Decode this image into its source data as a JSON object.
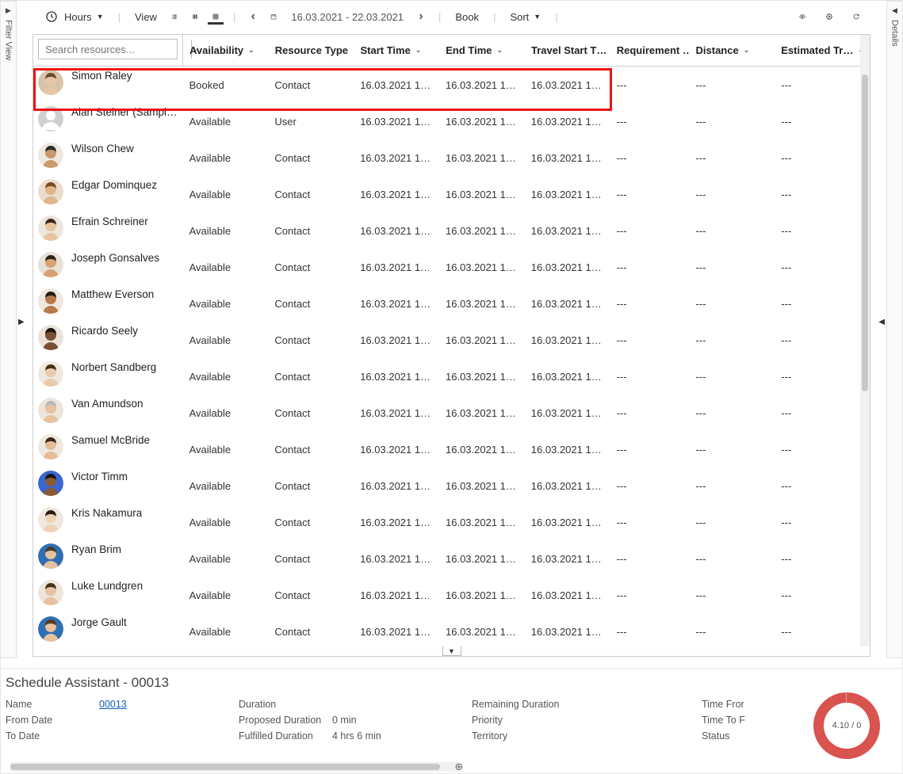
{
  "toolbar": {
    "hours_label": "Hours",
    "view_label": "View",
    "date_range": "16.03.2021 - 22.03.2021",
    "book_label": "Book",
    "sort_label": "Sort"
  },
  "side": {
    "left_label": "Filter View",
    "right_label": "Details"
  },
  "search": {
    "placeholder": "Search resources..."
  },
  "columns": {
    "availability": "Availability",
    "resource_type": "Resource Type",
    "start_time": "Start Time",
    "end_time": "End Time",
    "travel_start": "Travel Start T…",
    "requirement": "Requirement …",
    "distance": "Distance",
    "estimated": "Estimated Tr…"
  },
  "rows": [
    {
      "name": "Simon Raley",
      "availability": "Booked",
      "type": "Contact",
      "start": "16.03.2021 1…",
      "end": "16.03.2021 1…",
      "travel": "16.03.2021 1…",
      "req": "---",
      "dist": "---",
      "est": "---",
      "avatarBg": "#d8c4a8",
      "avatarSkin": "#e6c8a8",
      "avatarHair": "#6b4a2e"
    },
    {
      "name": "Alan Steiner (Sampl…",
      "availability": "Available",
      "type": "User",
      "start": "16.03.2021 1…",
      "end": "16.03.2021 1…",
      "travel": "16.03.2021 1…",
      "req": "---",
      "dist": "---",
      "est": "---",
      "placeholder": true
    },
    {
      "name": "Wilson Chew",
      "availability": "Available",
      "type": "Contact",
      "start": "16.03.2021 1…",
      "end": "16.03.2021 1…",
      "travel": "16.03.2021 1…",
      "req": "---",
      "dist": "---",
      "est": "---",
      "avatarBg": "#efe8df",
      "avatarSkin": "#c99a6b",
      "avatarHair": "#2b2b2b"
    },
    {
      "name": "Edgar Dominquez",
      "availability": "Available",
      "type": "Contact",
      "start": "16.03.2021 1…",
      "end": "16.03.2021 1…",
      "travel": "16.03.2021 1…",
      "req": "---",
      "dist": "---",
      "est": "---",
      "avatarBg": "#e9ddce",
      "avatarSkin": "#e2b58b",
      "avatarHair": "#7a4a20"
    },
    {
      "name": "Efrain Schreiner",
      "availability": "Available",
      "type": "Contact",
      "start": "16.03.2021 1…",
      "end": "16.03.2021 1…",
      "travel": "16.03.2021 1…",
      "req": "---",
      "dist": "---",
      "est": "---",
      "avatarBg": "#ece6dc",
      "avatarSkin": "#e8c3a0",
      "avatarHair": "#3a2a1a"
    },
    {
      "name": "Joseph Gonsalves",
      "availability": "Available",
      "type": "Contact",
      "start": "16.03.2021 1…",
      "end": "16.03.2021 1…",
      "travel": "16.03.2021 1…",
      "req": "---",
      "dist": "---",
      "est": "---",
      "avatarBg": "#e7e1d7",
      "avatarSkin": "#d8a073",
      "avatarHair": "#2f2014"
    },
    {
      "name": "Matthew Everson",
      "availability": "Available",
      "type": "Contact",
      "start": "16.03.2021 1…",
      "end": "16.03.2021 1…",
      "travel": "16.03.2021 1…",
      "req": "---",
      "dist": "---",
      "est": "---",
      "avatarBg": "#eee7de",
      "avatarSkin": "#b87a4a",
      "avatarHair": "#1f1a14"
    },
    {
      "name": "Ricardo Seely",
      "availability": "Available",
      "type": "Contact",
      "start": "16.03.2021 1…",
      "end": "16.03.2021 1…",
      "travel": "16.03.2021 1…",
      "req": "---",
      "dist": "---",
      "est": "---",
      "avatarBg": "#eae3da",
      "avatarSkin": "#7a4f33",
      "avatarHair": "#1a1410"
    },
    {
      "name": "Norbert Sandberg",
      "availability": "Available",
      "type": "Contact",
      "start": "16.03.2021 1…",
      "end": "16.03.2021 1…",
      "travel": "16.03.2021 1…",
      "req": "---",
      "dist": "---",
      "est": "---",
      "avatarBg": "#efe8df",
      "avatarSkin": "#e9caab",
      "avatarHair": "#453018"
    },
    {
      "name": "Van Amundson",
      "availability": "Available",
      "type": "Contact",
      "start": "16.03.2021 1…",
      "end": "16.03.2021 1…",
      "travel": "16.03.2021 1…",
      "req": "---",
      "dist": "---",
      "est": "---",
      "avatarBg": "#ece5db",
      "avatarSkin": "#e6c2a0",
      "avatarHair": "#b7b7b7"
    },
    {
      "name": "Samuel McBride",
      "availability": "Available",
      "type": "Contact",
      "start": "16.03.2021 1…",
      "end": "16.03.2021 1…",
      "travel": "16.03.2021 1…",
      "req": "---",
      "dist": "---",
      "est": "---",
      "avatarBg": "#eee8df",
      "avatarSkin": "#e4bd98",
      "avatarHair": "#3a281a"
    },
    {
      "name": "Victor Timm",
      "availability": "Available",
      "type": "Contact",
      "start": "16.03.2021 1…",
      "end": "16.03.2021 1…",
      "travel": "16.03.2021 1…",
      "req": "---",
      "dist": "---",
      "est": "---",
      "avatarBg": "#3a66d1",
      "avatarSkin": "#8a5a38",
      "avatarHair": "#1b140e"
    },
    {
      "name": "Kris Nakamura",
      "availability": "Available",
      "type": "Contact",
      "start": "16.03.2021 1…",
      "end": "16.03.2021 1…",
      "travel": "16.03.2021 1…",
      "req": "---",
      "dist": "---",
      "est": "---",
      "avatarBg": "#efe8df",
      "avatarSkin": "#efd2b4",
      "avatarHair": "#2a1c10"
    },
    {
      "name": "Ryan Brim",
      "availability": "Available",
      "type": "Contact",
      "start": "16.03.2021 1…",
      "end": "16.03.2021 1…",
      "travel": "16.03.2021 1…",
      "req": "---",
      "dist": "---",
      "est": "---",
      "avatarBg": "#2f6fb3",
      "avatarSkin": "#e7c2a0",
      "avatarHair": "#4a3a2a"
    },
    {
      "name": "Luke Lundgren",
      "availability": "Available",
      "type": "Contact",
      "start": "16.03.2021 1…",
      "end": "16.03.2021 1…",
      "travel": "16.03.2021 1…",
      "req": "---",
      "dist": "---",
      "est": "---",
      "avatarBg": "#ece5db",
      "avatarSkin": "#e7c2a0",
      "avatarHair": "#443018"
    },
    {
      "name": "Jorge Gault",
      "availability": "Available",
      "type": "Contact",
      "start": "16.03.2021 1…",
      "end": "16.03.2021 1…",
      "travel": "16.03.2021 1…",
      "req": "---",
      "dist": "---",
      "est": "---",
      "avatarBg": "#2f6fb3",
      "avatarSkin": "#e7c2a0",
      "avatarHair": "#5a3a1a"
    }
  ],
  "bottom": {
    "title": "Schedule Assistant - 00013",
    "col1": {
      "name": "Name",
      "from": "From Date",
      "to": "To Date",
      "name_value": "00013"
    },
    "col2": {
      "duration": "Duration",
      "proposed": "Proposed Duration",
      "fulfilled": "Fulfilled Duration",
      "proposed_val": "0 min",
      "fulfilled_val": "4 hrs 6 min"
    },
    "col3": {
      "remaining": "Remaining Duration",
      "priority": "Priority",
      "territory": "Territory"
    },
    "col4": {
      "timefrom": "Time Fror",
      "timeto": "Time To F",
      "status": "Status"
    },
    "donut_text": "4.10 / 0"
  }
}
